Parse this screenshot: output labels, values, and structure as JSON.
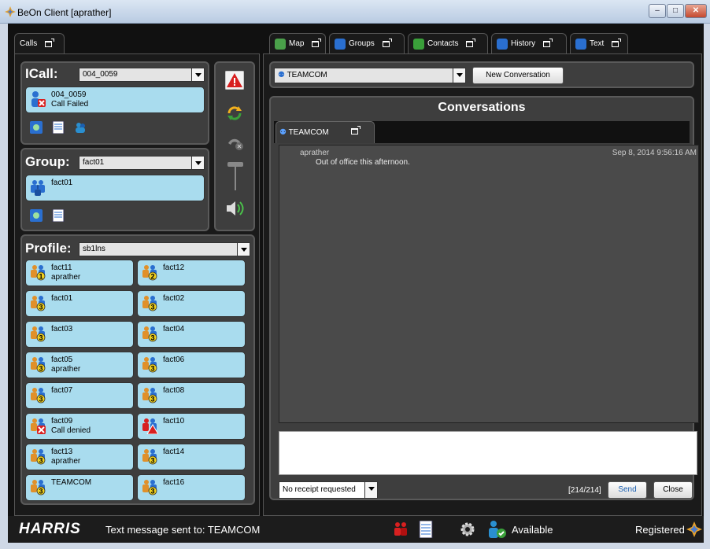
{
  "window": {
    "title": "BeOn Client [aprather]",
    "btn_min": "–",
    "btn_max": "□",
    "btn_close": "✕"
  },
  "calls_tab": {
    "label": "Calls"
  },
  "right_tabs": [
    {
      "label": "Map",
      "icon": "map-icon"
    },
    {
      "label": "Groups",
      "icon": "groups-icon"
    },
    {
      "label": "Contacts",
      "icon": "contacts-icon"
    },
    {
      "label": "History",
      "icon": "history-icon"
    },
    {
      "label": "Text",
      "icon": "text-icon"
    }
  ],
  "icall": {
    "label": "ICall:",
    "selected": "004_0059",
    "card_name": "004_0059",
    "card_status": "Call Failed"
  },
  "group": {
    "label": "Group:",
    "selected": "fact01",
    "card_name": "fact01"
  },
  "profile": {
    "label": "Profile:",
    "selected": "sb1lns",
    "cards": [
      {
        "name": "fact11",
        "sub": "aprather",
        "badge": "1"
      },
      {
        "name": "fact12",
        "sub": "",
        "badge": "2"
      },
      {
        "name": "fact01",
        "sub": "",
        "badge": "3"
      },
      {
        "name": "fact02",
        "sub": "",
        "badge": "3"
      },
      {
        "name": "fact03",
        "sub": "",
        "badge": "3"
      },
      {
        "name": "fact04",
        "sub": "",
        "badge": "3"
      },
      {
        "name": "fact05",
        "sub": "aprather",
        "badge": "3"
      },
      {
        "name": "fact06",
        "sub": "",
        "badge": "3"
      },
      {
        "name": "fact07",
        "sub": "",
        "badge": "3"
      },
      {
        "name": "fact08",
        "sub": "",
        "badge": "3"
      },
      {
        "name": "fact09",
        "sub": "Call denied",
        "badge": "x"
      },
      {
        "name": "fact10",
        "sub": "",
        "badge": "!"
      },
      {
        "name": "fact13",
        "sub": "aprather",
        "badge": "3"
      },
      {
        "name": "fact14",
        "sub": "",
        "badge": "3"
      },
      {
        "name": "TEAMCOM",
        "sub": "",
        "badge": "3"
      },
      {
        "name": "fact16",
        "sub": "",
        "badge": "3"
      }
    ]
  },
  "text_panel": {
    "group_select": "TEAMCOM",
    "new_conversation": "New Conversation",
    "header": "Conversations",
    "conv_tab": "TEAMCOM",
    "message": {
      "sender": "aprather",
      "time": "Sep 8, 2014 9:56:16 AM",
      "text": "Out of office this afternoon."
    },
    "input_value": "",
    "receipt_select": "No receipt requested",
    "counter": "[214/214]",
    "send": "Send",
    "close": "Close"
  },
  "statusbar": {
    "logo": "HARRIS",
    "message": "Text message sent to: TEAMCOM",
    "presence": "Available",
    "registration": "Registered"
  },
  "colors": {
    "card_bg": "#a9dcee",
    "panel_bg": "#3e3e3e",
    "app_bg": "#111111",
    "emergency_red": "#d82020"
  }
}
